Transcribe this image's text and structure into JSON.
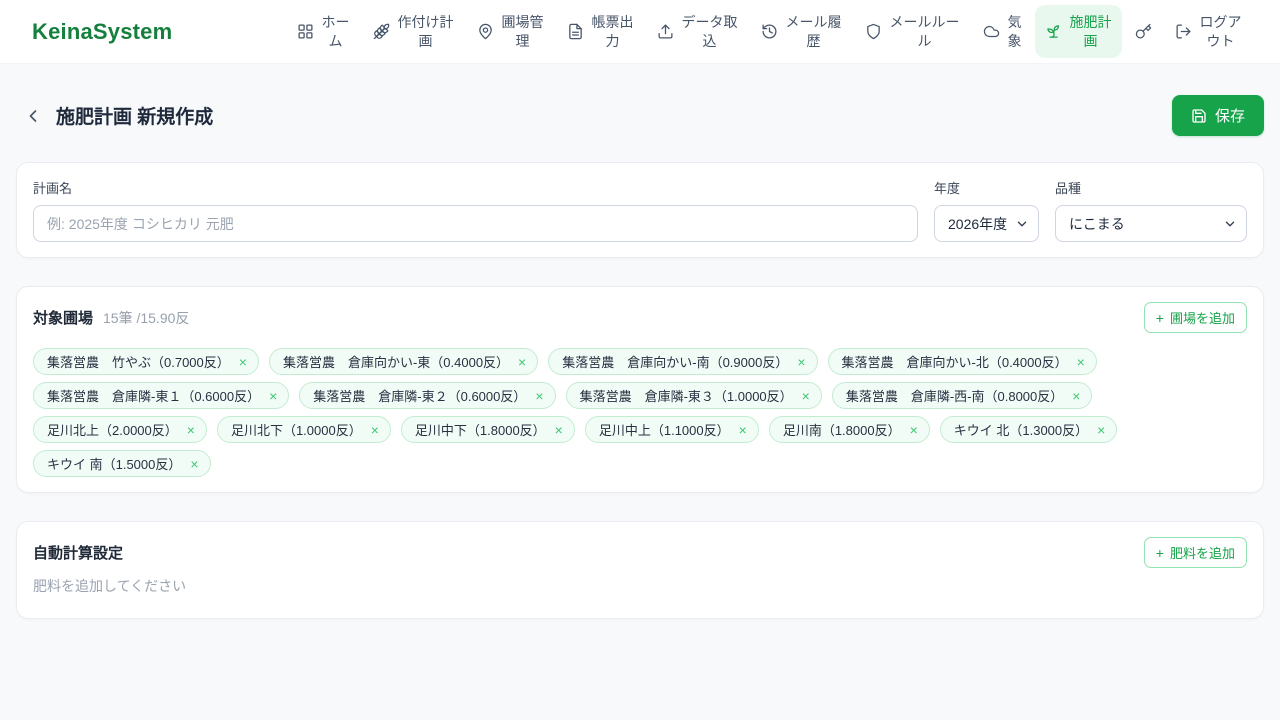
{
  "brand": "KeinaSystem",
  "nav": {
    "items": [
      {
        "label": "ホーム",
        "icon": "grid-icon"
      },
      {
        "label": "作付け計画",
        "icon": "wheat-icon"
      },
      {
        "label": "圃場管理",
        "icon": "map-pin-icon"
      },
      {
        "label": "帳票出力",
        "icon": "document-icon"
      },
      {
        "label": "データ取込",
        "icon": "upload-icon"
      },
      {
        "label": "メール履歴",
        "icon": "history-icon"
      },
      {
        "label": "メールルール",
        "icon": "shield-icon"
      },
      {
        "label": "気象",
        "icon": "cloud-icon"
      },
      {
        "label": "施肥計画",
        "icon": "sprout-icon",
        "active": true
      },
      {
        "label": "",
        "icon": "key-icon"
      },
      {
        "label": "ログアウト",
        "icon": "logout-icon"
      }
    ]
  },
  "header": {
    "title": "施肥計画 新規作成",
    "save_label": "保存"
  },
  "form": {
    "plan_name": {
      "label": "計画名",
      "placeholder": "例: 2025年度 コシヒカリ 元肥",
      "value": ""
    },
    "year": {
      "label": "年度",
      "value": "2026年度"
    },
    "variety": {
      "label": "品種",
      "value": "にこまる"
    }
  },
  "fields_section": {
    "title": "対象圃場",
    "summary": "15筆 /15.90反",
    "add_button_label": "圃場を追加",
    "items": [
      {
        "label": "集落営農　竹やぶ（0.7000反）"
      },
      {
        "label": "集落営農　倉庫向かい-東（0.4000反）"
      },
      {
        "label": "集落営農　倉庫向かい-南（0.9000反）"
      },
      {
        "label": "集落営農　倉庫向かい-北（0.4000反）"
      },
      {
        "label": "集落営農　倉庫隣-東１（0.6000反）"
      },
      {
        "label": "集落営農　倉庫隣-東２（0.6000反）"
      },
      {
        "label": "集落営農　倉庫隣-東３（1.0000反）"
      },
      {
        "label": "集落営農　倉庫隣-西-南（0.8000反）"
      },
      {
        "label": "足川北上（2.0000反）"
      },
      {
        "label": "足川北下（1.0000反）"
      },
      {
        "label": "足川中下（1.8000反）"
      },
      {
        "label": "足川中上（1.1000反）"
      },
      {
        "label": "足川南（1.8000反）"
      },
      {
        "label": "キウイ 北（1.3000反）"
      },
      {
        "label": "キウイ 南（1.5000反）"
      }
    ]
  },
  "auto_calc_section": {
    "title": "自動計算設定",
    "add_button_label": "肥料を追加",
    "empty_message": "肥料を追加してください"
  },
  "icons": {
    "plus": "+",
    "close": "×"
  },
  "colors": {
    "brand_green": "#15803d",
    "accent_green": "#16a34a",
    "active_nav_bg": "#e9f8ef"
  }
}
